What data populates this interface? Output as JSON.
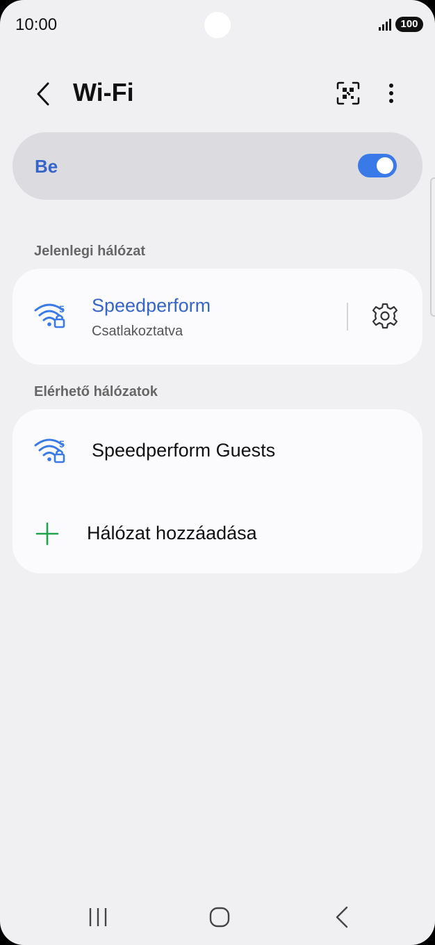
{
  "status_bar": {
    "time": "10:00",
    "battery": "100"
  },
  "header": {
    "title": "Wi-Fi"
  },
  "master_switch": {
    "label": "Be",
    "on": true
  },
  "current_section": {
    "header": "Jelenlegi hálózat",
    "network": {
      "name": "Speedperform",
      "status": "Csatlakoztatva",
      "band": "5"
    }
  },
  "available_section": {
    "header": "Elérhető hálózatok",
    "networks": [
      {
        "name": "Speedperform Guests",
        "band": "5"
      }
    ],
    "add_network_label": "Hálózat hozzáadása"
  },
  "colors": {
    "accent": "#3665c9",
    "toggle": "#3a7ae8",
    "add": "#1fa34a"
  },
  "icons": [
    "back-icon",
    "qr-code-icon",
    "more-icon",
    "wifi-locked-icon",
    "gear-icon",
    "plus-icon",
    "recents-icon",
    "home-icon",
    "nav-back-icon"
  ]
}
